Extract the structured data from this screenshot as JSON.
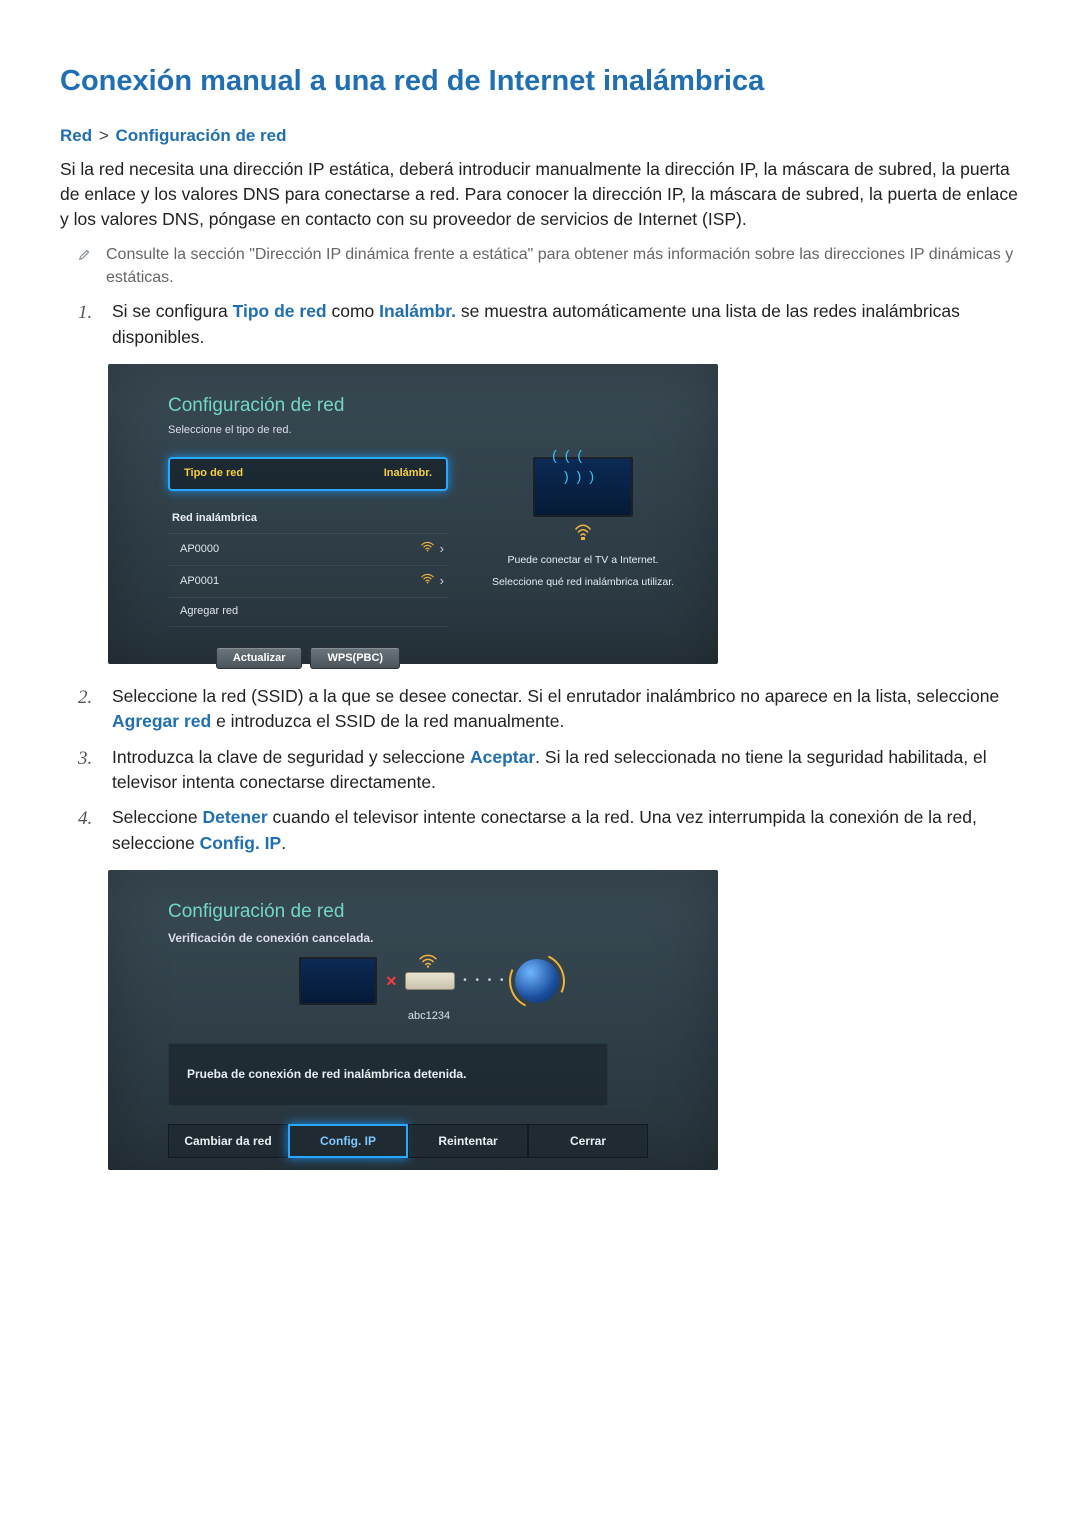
{
  "title": "Conexión manual a una red de Internet inalámbrica",
  "breadcrumb": {
    "a": "Red",
    "sep": ">",
    "b": "Configuración de red"
  },
  "intro": "Si la red necesita una dirección IP estática, deberá introducir manualmente la dirección IP, la máscara de subred, la puerta de enlace y los valores DNS para conectarse a red. Para conocer la dirección IP, la máscara de subred, la puerta de enlace y los valores DNS, póngase en contacto con su proveedor de servicios de Internet (ISP).",
  "note": "Consulte la sección \"Dirección IP dinámica frente a estática\" para obtener más información sobre las direcciones IP dinámicas y estáticas.",
  "steps": {
    "s1a": "Si se configura ",
    "s1b": "Tipo de red",
    "s1c": " como ",
    "s1d": "Inalámbr.",
    "s1e": " se muestra automáticamente una lista de las redes inalámbricas disponibles.",
    "s2a": "Seleccione la red (SSID) a la que se desee conectar. Si el enrutador inalámbrico no aparece en la lista, seleccione ",
    "s2b": "Agregar red",
    "s2c": " e introduzca el SSID de la red manualmente.",
    "s3a": "Introduzca la clave de seguridad y seleccione ",
    "s3b": "Aceptar",
    "s3c": ". Si la red seleccionada no tiene la seguridad habilitada, el televisor intenta conectarse directamente.",
    "s4a": "Seleccione ",
    "s4b": "Detener",
    "s4c": " cuando el televisor intente conectarse a la red. Una vez interrumpida la conexión de la red, seleccione ",
    "s4d": "Config. IP",
    "s4e": "."
  },
  "screen1": {
    "title": "Configuración de red",
    "sub": "Seleccione el tipo de red.",
    "sel_label": "Tipo de red",
    "sel_value": "Inalámbr.",
    "section": "Red inalámbrica",
    "aps": [
      "AP0000",
      "AP0001"
    ],
    "add": "Agregar red",
    "btn_refresh": "Actualizar",
    "btn_wps": "WPS(PBC)",
    "right1": "Puede conectar el TV a Internet.",
    "right2": "Seleccione qué red inalámbrica utilizar."
  },
  "screen2": {
    "title": "Configuración de red",
    "sub": "Verificación de conexión cancelada.",
    "ssid": "abc1234",
    "msg": "Prueba de conexión de red inalámbrica detenida.",
    "btns": [
      "Cambiar da red",
      "Config. IP",
      "Reintentar",
      "Cerrar"
    ],
    "active_index": 1
  }
}
